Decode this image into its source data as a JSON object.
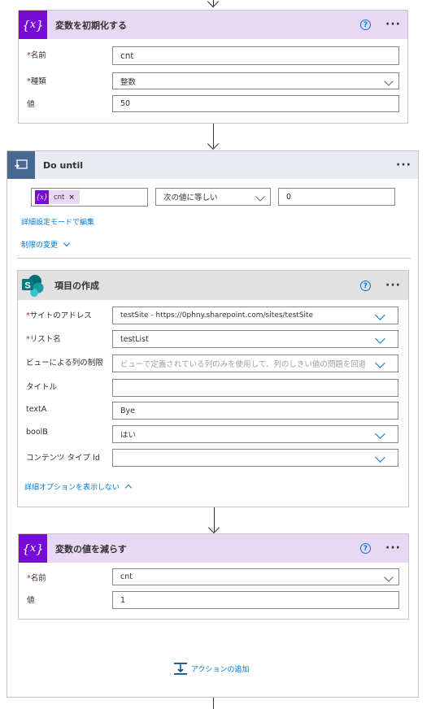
{
  "init_card": {
    "title": "変数を初期化する",
    "help": "?",
    "name_label": "名前",
    "name_value": "cnt",
    "type_label": "種類",
    "type_value": "整数",
    "value_label": "値",
    "value_value": "50"
  },
  "loop_card": {
    "title": "Do until",
    "token_label": "cnt",
    "token_remove": "×",
    "operator": "次の値に等しい",
    "compare_value": "0",
    "advanced_link": "詳細設定モードで編集",
    "limits_link": "制限の変更"
  },
  "create_item": {
    "title": "項目の作成",
    "help": "?",
    "site_label": "サイトのアドレス",
    "site_value": "testSite - https://0phny.sharepoint.com/sites/testSite",
    "list_label": "リスト名",
    "list_value": "testList",
    "view_label": "ビューによる列の制限",
    "view_placeholder": "ビューで定義されている列のみを使用して、列のしきい値の問題を回避しま",
    "title_label": "タイトル",
    "title_value": "",
    "texta_label": "textA",
    "texta_value": "Bye",
    "boolb_label": "boolB",
    "boolb_value": "はい",
    "ctype_label": "コンテンツ タイプ Id",
    "ctype_value": "",
    "hide_options_link": "詳細オプションを表示しない"
  },
  "decrement_card": {
    "title": "変数の値を減らす",
    "help": "?",
    "name_label": "名前",
    "name_value": "cnt",
    "value_label": "値",
    "value_value": "1"
  },
  "add_action": {
    "label": "アクションの追加"
  },
  "colors": {
    "variable_accent": "#770bd6",
    "variable_header": "#e9d8f3",
    "loop_accent": "#486991",
    "loop_header": "#e8ebf2",
    "sharepoint_header": "#e1e1e1",
    "link": "#0078d4",
    "required": "#a4262c"
  },
  "icons": {
    "variable": "variable-braces-icon",
    "loop": "do-until-loop-icon",
    "sharepoint": "sharepoint-icon",
    "help": "help-circle-icon",
    "more": "more-ellipsis-icon",
    "add_action": "add-action-icon"
  }
}
